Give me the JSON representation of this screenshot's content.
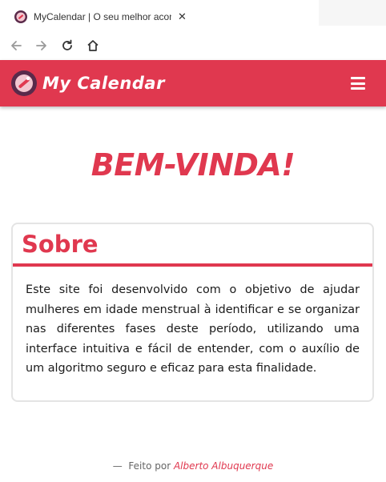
{
  "browser": {
    "tab_title": "MyCalendar | O seu melhor acom",
    "tab_close": "✕",
    "back_icon": "arrow-left-icon",
    "forward_icon": "arrow-right-icon",
    "reload_icon": "reload-icon",
    "home_icon": "home-icon"
  },
  "header": {
    "brand": "My Calendar",
    "menu_icon": "hamburger-menu-icon",
    "color": "#e0384f"
  },
  "main": {
    "welcome": "BEM-VINDA!",
    "about": {
      "title": "Sobre",
      "text": "Este site foi desenvolvido com o objetivo de ajudar mulheres em idade menstrual à identificar e se organizar nas diferentes fases deste período, utilizando uma interface intuitiva e fácil de entender, com o auxílio de um algoritmo seguro e eficaz para esta finalidade."
    }
  },
  "footer": {
    "dash": "—",
    "prefix": "Feito por",
    "author": "Alberto Albuquerque"
  }
}
